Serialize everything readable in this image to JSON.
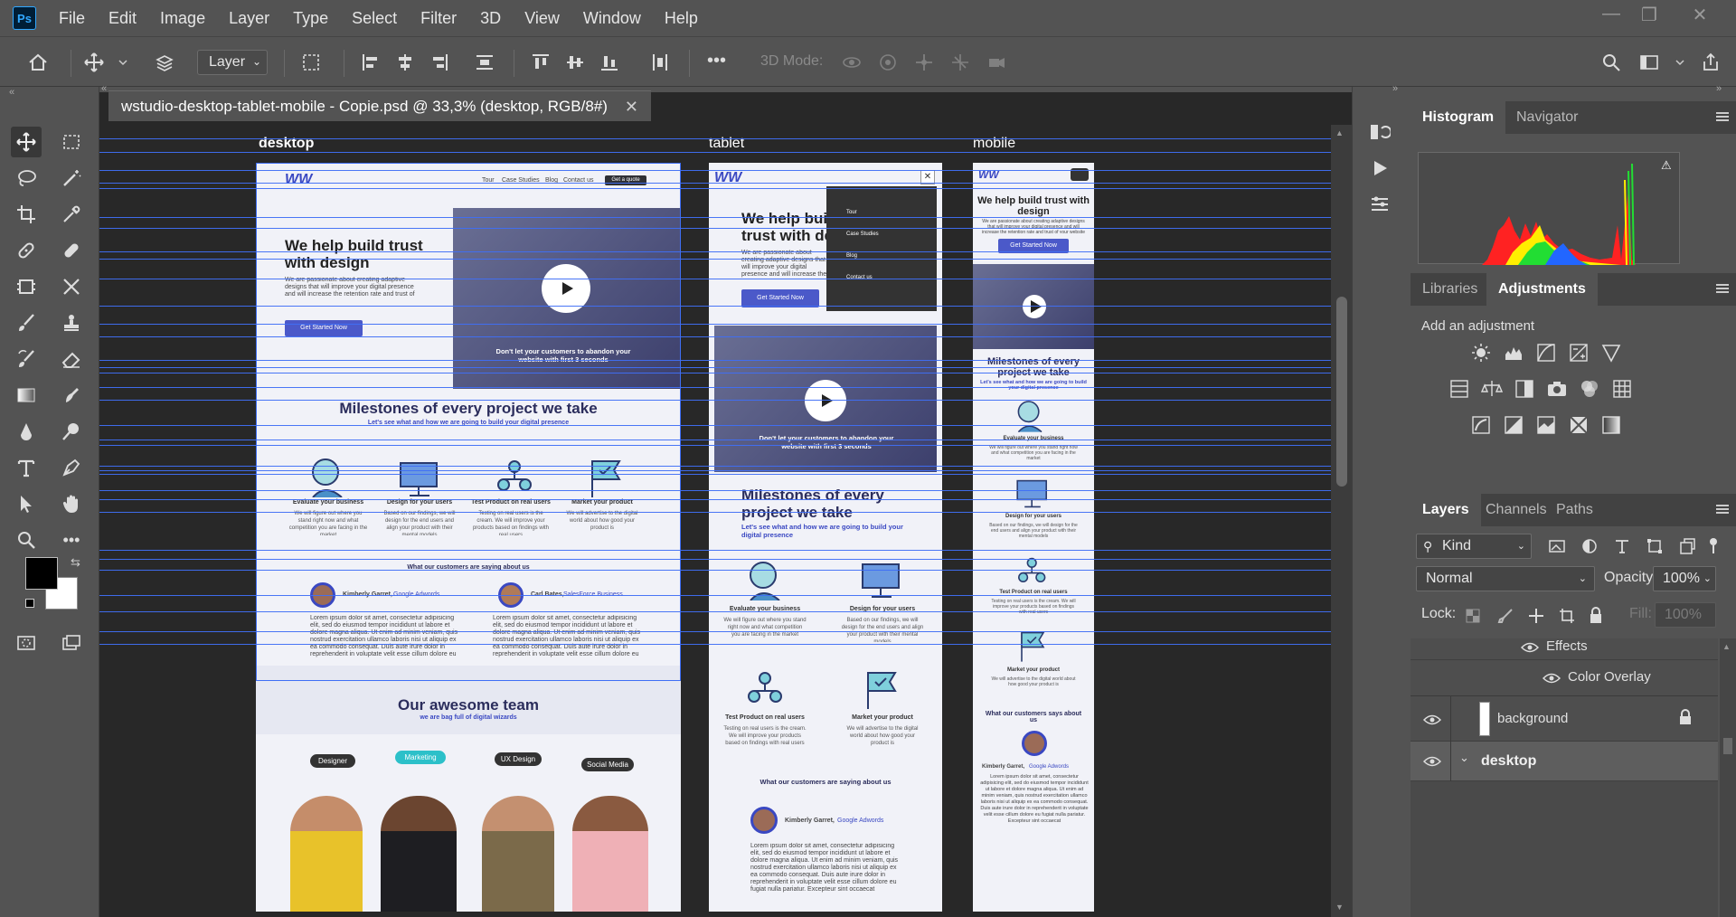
{
  "app": {
    "logo": "Ps"
  },
  "menu": [
    "File",
    "Edit",
    "Image",
    "Layer",
    "Type",
    "Select",
    "Filter",
    "3D",
    "View",
    "Window",
    "Help"
  ],
  "window_controls": {
    "minimize": "—",
    "restore": "❐",
    "close": "✕"
  },
  "options_bar": {
    "layer_dropdown": "Layer",
    "three_d_mode": "3D Mode:",
    "more": "•••"
  },
  "document": {
    "tab_title": "wstudio-desktop-tablet-mobile - Copie.psd @ 33,3% (desktop, RGB/8#)",
    "close": "✕",
    "artboards": [
      "desktop",
      "tablet",
      "mobile"
    ]
  },
  "mock": {
    "logo": "WW",
    "nav": [
      "Tour",
      "Case Studies",
      "Blog",
      "Contact us"
    ],
    "nav_cta": "Get a quote",
    "hero_title": "We help build trust with design",
    "hero_text": "We are passionate about creating adaptive designs that will improve your digital presence and will increase the retention rate and trust of your website visitors",
    "hero_cta": "Get Started Now",
    "video_caption": "Don't let your customers to abandon your website with first 3 seconds",
    "milestones_title": "Milestones of every project we take",
    "milestones_sub": "Let's see what and how we are going to build your digital presence",
    "features": [
      {
        "title": "Evaluate your business",
        "text": "We will figure out where you stand right now and what competition you are facing in the market"
      },
      {
        "title": "Design for your users",
        "text": "Based on our findings, we will design for the end users and align your product with their mental models"
      },
      {
        "title": "Test Product on real users",
        "text": "Testing on real users is the cream. We will improve your products based on findings with real users"
      },
      {
        "title": "Market your product",
        "text": "We will advertise to the digital world about how good your product is"
      }
    ],
    "testimonials_title": "What our customers are saying about us",
    "testimonials_title_mobile": "What our customers says about us",
    "t1_name": "Kimberly Garret,",
    "t1_company": "Google Adwords",
    "t2_name": "Carl Bates,",
    "t2_company": "SalesForce Business",
    "lorem": "Lorem ipsum dolor sit amet, consectetur adipisicing elit, sed do eiusmod tempor incididunt ut labore et dolore magna aliqua. Ut enim ad minim veniam, quis nostrud exercitation ullamco laboris nisi ut aliquip ex ea commodo consequat. Duis aute irure dolor in reprehenderit in voluptate velit esse cillum dolore eu fugiat nulla pariatur. Excepteur sint occaecat",
    "team_title": "Our awesome team",
    "team_sub": "we are bag full of digital wizards",
    "team_tags": [
      "Designer",
      "Marketing",
      "UX Design",
      "Social Media"
    ],
    "menu_close": "✕"
  },
  "panels": {
    "histogram_tabs": [
      "Histogram",
      "Navigator"
    ],
    "mid_tabs": [
      "Libraries",
      "Adjustments"
    ],
    "add_adjustment": "Add an adjustment",
    "layers_tabs": [
      "Layers",
      "Channels",
      "Paths"
    ],
    "kind": "Kind",
    "blend_mode": "Normal",
    "opacity_label": "Opacity:",
    "opacity_value": "100%",
    "lock_label": "Lock:",
    "fill_label": "Fill:",
    "fill_value": "100%",
    "layers": [
      {
        "name": "Effects"
      },
      {
        "name": "Color Overlay"
      },
      {
        "name": "background"
      },
      {
        "name": "desktop"
      }
    ]
  },
  "colors": {
    "ui_bg": "#535353",
    "canvas_bg": "#282828",
    "guide": "#3f6ff5",
    "accent_blue": "#4b59c9",
    "brand_navy": "#2b2d5c"
  }
}
